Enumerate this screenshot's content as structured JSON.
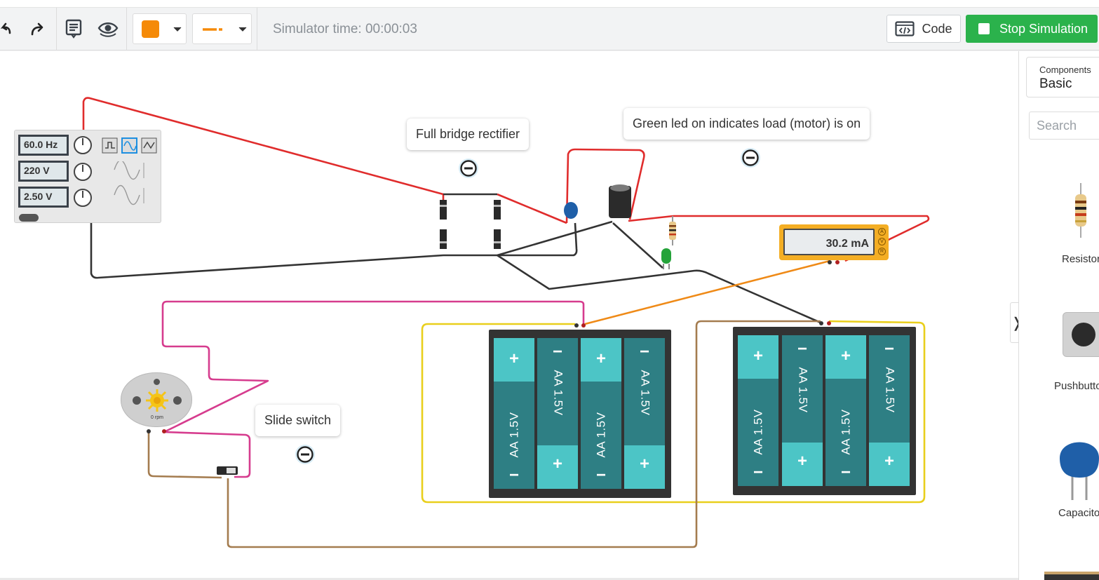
{
  "toolbar": {
    "simulator_time": "Simulator time: 00:00:03",
    "code_label": "Code",
    "stop_label": "Stop Simulation",
    "wire_color": "#f58a07",
    "accent_green": "#2bb24c"
  },
  "panel": {
    "components_label": "Components",
    "category": "Basic",
    "search_placeholder": "Search",
    "items": [
      {
        "label": "Resistor"
      },
      {
        "label": "Pushbutton"
      },
      {
        "label": "Capacitor"
      }
    ]
  },
  "canvas": {
    "notes": {
      "bridge": "Full bridge rectifier",
      "led": "Green led on indicates load (motor) is on",
      "switch": "Slide switch"
    },
    "function_generator": {
      "frequency": "60.0 Hz",
      "amplitude": "220 V",
      "offset": "2.50 V"
    },
    "multimeter": {
      "reading": "30.2 mA",
      "modes": [
        "A",
        "V",
        "R"
      ]
    },
    "motor": {
      "speed": "0 rpm"
    },
    "battery_cell_label": "AA 1.5V",
    "plus": "+",
    "minus": "−"
  }
}
